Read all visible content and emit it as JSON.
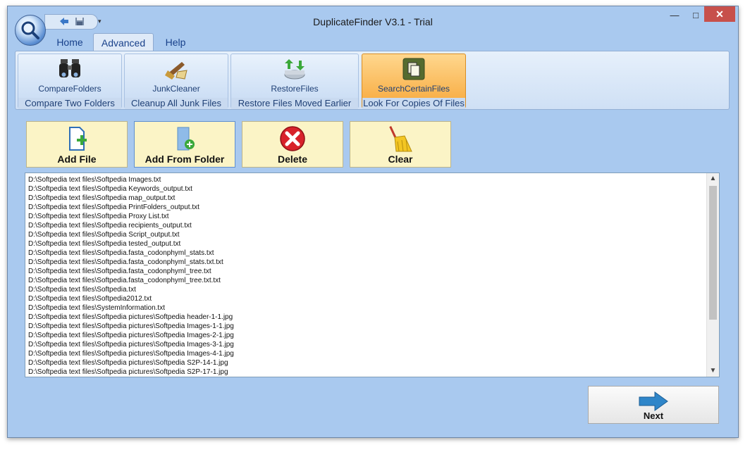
{
  "window": {
    "title": "DuplicateFinder V3.1 - Trial",
    "minimize": "—",
    "maximize": "□",
    "close": "✕"
  },
  "tabs": [
    {
      "label": "Home"
    },
    {
      "label": "Advanced",
      "active": true
    },
    {
      "label": "Help"
    }
  ],
  "ribbon": {
    "groups": [
      {
        "command": "CompareFolders",
        "caption": "Compare Two Folders",
        "icon": "binoculars-icon"
      },
      {
        "command": "JunkCleaner",
        "caption": "Cleanup All Junk Files",
        "icon": "junk-cleaner-icon"
      },
      {
        "command": "RestoreFiles",
        "caption": "Restore Files Moved Earlier",
        "icon": "restore-icon"
      },
      {
        "command": "SearchCertainFiles",
        "caption": "Look For Copies Of Files",
        "icon": "copy-files-icon",
        "selected": true
      }
    ]
  },
  "toolbar": {
    "add_file": "Add File",
    "add_from_folder": "Add From Folder",
    "delete": "Delete",
    "clear": "Clear"
  },
  "files": [
    "D:\\Softpedia text files\\Softpedia Images.txt",
    "D:\\Softpedia text files\\Softpedia Keywords_output.txt",
    "D:\\Softpedia text files\\Softpedia map_output.txt",
    "D:\\Softpedia text files\\Softpedia PrintFolders_output.txt",
    "D:\\Softpedia text files\\Softpedia Proxy List.txt",
    "D:\\Softpedia text files\\Softpedia recipients_output.txt",
    "D:\\Softpedia text files\\Softpedia Script_output.txt",
    "D:\\Softpedia text files\\Softpedia tested_output.txt",
    "D:\\Softpedia text files\\Softpedia.fasta_codonphyml_stats.txt",
    "D:\\Softpedia text files\\Softpedia.fasta_codonphyml_stats.txt.txt",
    "D:\\Softpedia text files\\Softpedia.fasta_codonphyml_tree.txt",
    "D:\\Softpedia text files\\Softpedia.fasta_codonphyml_tree.txt.txt",
    "D:\\Softpedia text files\\Softpedia.txt",
    "D:\\Softpedia text files\\Softpedia2012.txt",
    "D:\\Softpedia text files\\SystemInformation.txt",
    "D:\\Softpedia text files\\Softpedia pictures\\Softpedia header-1-1.jpg",
    "D:\\Softpedia text files\\Softpedia pictures\\Softpedia Images-1-1.jpg",
    "D:\\Softpedia text files\\Softpedia pictures\\Softpedia Images-2-1.jpg",
    "D:\\Softpedia text files\\Softpedia pictures\\Softpedia Images-3-1.jpg",
    "D:\\Softpedia text files\\Softpedia pictures\\Softpedia Images-4-1.jpg",
    "D:\\Softpedia text files\\Softpedia pictures\\Softpedia S2P-14-1.jpg",
    "D:\\Softpedia text files\\Softpedia pictures\\Softpedia S2P-17-1.jpg"
  ],
  "next_button": {
    "label": "Next"
  },
  "scrollbar": {
    "up": "▲",
    "down": "▼"
  }
}
